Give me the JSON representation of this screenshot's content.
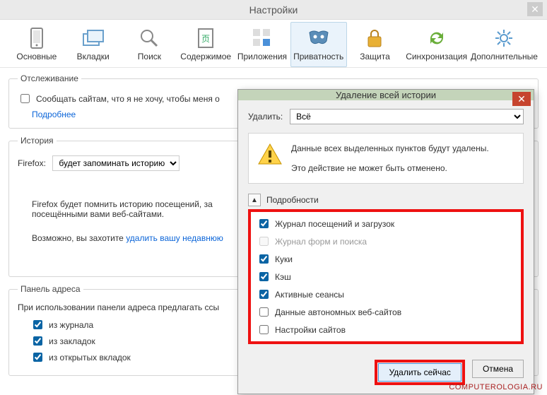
{
  "window": {
    "title": "Настройки"
  },
  "toolbar": {
    "items": [
      {
        "label": "Основные"
      },
      {
        "label": "Вкладки"
      },
      {
        "label": "Поиск"
      },
      {
        "label": "Содержимое"
      },
      {
        "label": "Приложения"
      },
      {
        "label": "Приватность",
        "active": true
      },
      {
        "label": "Защита"
      },
      {
        "label": "Синхронизация"
      },
      {
        "label": "Дополнительные"
      }
    ]
  },
  "tracking": {
    "legend": "Отслеживание",
    "checkbox_label": "Сообщать сайтам, что я не хочу, чтобы меня о",
    "link": "Подробнее"
  },
  "history": {
    "legend": "История",
    "app_label": "Firefox:",
    "select_value": "будет запоминать историю",
    "line1": "Firefox будет помнить историю посещений, за",
    "line2": "посещёнными вами веб-сайтами.",
    "line3_a": "Возможно, вы захотите ",
    "line3_link": "удалить вашу недавнюю"
  },
  "addressbar": {
    "legend": "Панель адреса",
    "intro": "При использовании панели адреса предлагать ссы",
    "cb1": "из журнала",
    "cb2": "из закладок",
    "cb3": "из открытых вкладок"
  },
  "dialog": {
    "title": "Удаление всей истории",
    "delete_label": "Удалить:",
    "delete_select": "Всё",
    "warn_line1": "Данные всех выделенных пунктов будут удалены.",
    "warn_line2": "Это действие не может быть отменено.",
    "details_label": "Подробности",
    "items": [
      {
        "label": "Журнал посещений и загрузок",
        "checked": true,
        "disabled": false
      },
      {
        "label": "Журнал форм и поиска",
        "checked": false,
        "disabled": true
      },
      {
        "label": "Куки",
        "checked": true,
        "disabled": false
      },
      {
        "label": "Кэш",
        "checked": true,
        "disabled": false
      },
      {
        "label": "Активные сеансы",
        "checked": true,
        "disabled": false
      },
      {
        "label": "Данные автономных веб-сайтов",
        "checked": false,
        "disabled": false
      },
      {
        "label": "Настройки сайтов",
        "checked": false,
        "disabled": false
      }
    ],
    "btn_primary": "Удалить сейчас",
    "btn_cancel": "Отмена"
  },
  "watermark": "COMPUTEROLOGIA.RU"
}
